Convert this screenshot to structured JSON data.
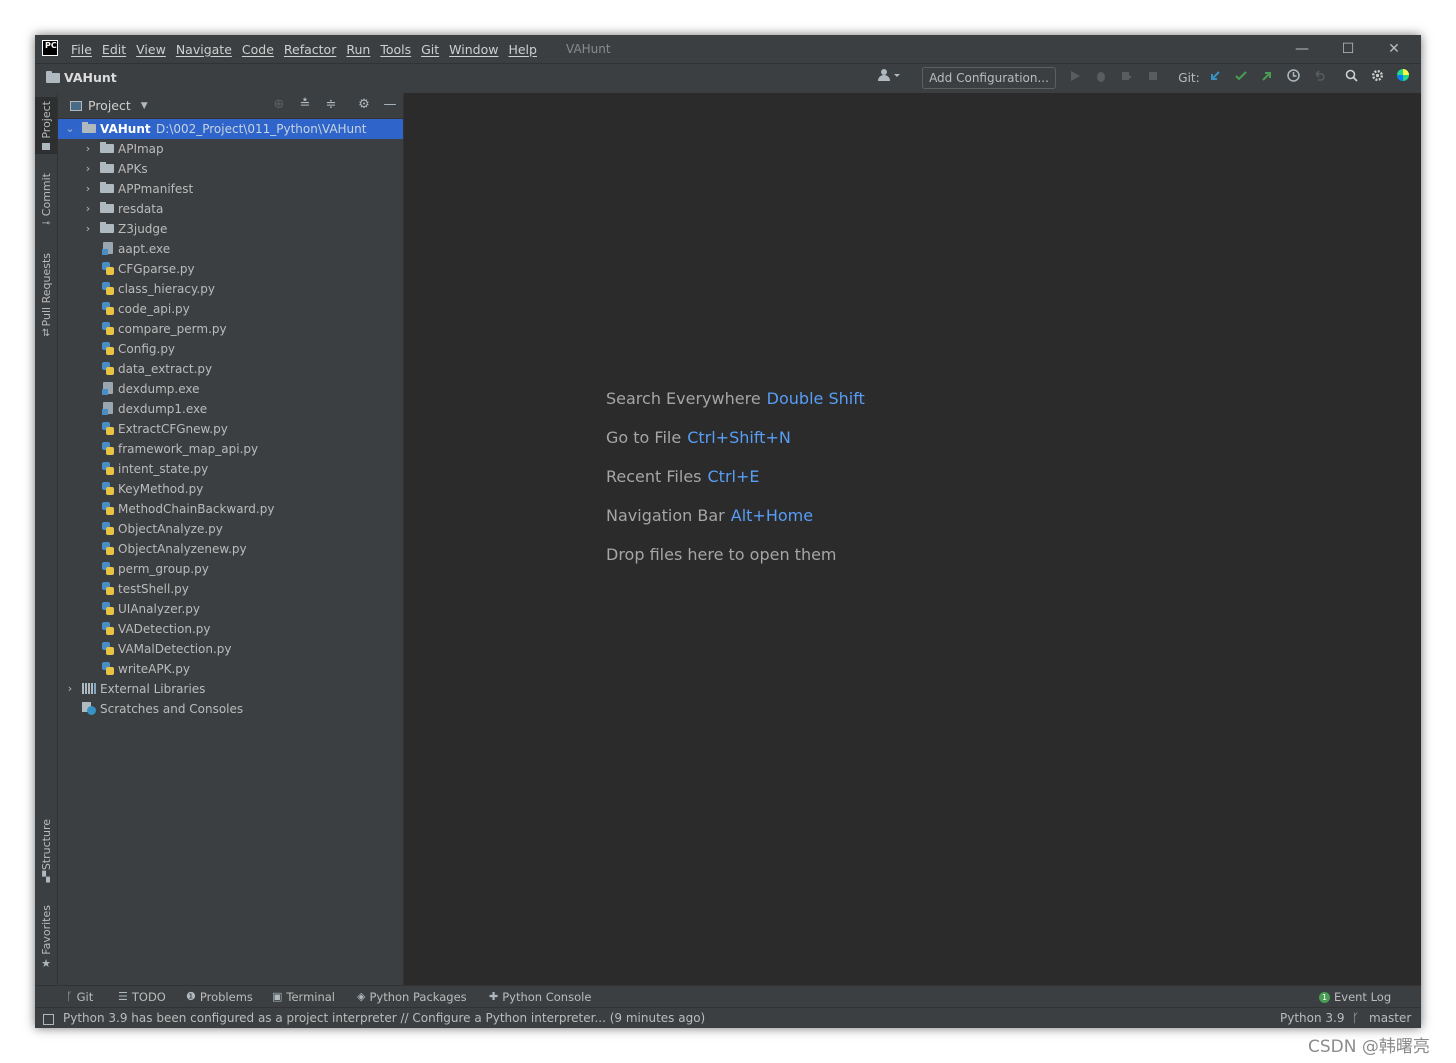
{
  "app": {
    "logo_text": "PC",
    "window_title": "VAHunt",
    "menu": [
      "File",
      "Edit",
      "View",
      "Navigate",
      "Code",
      "Refactor",
      "Run",
      "Tools",
      "Git",
      "Window",
      "Help"
    ]
  },
  "window_controls": {
    "minimize": "—",
    "maximize": "☐",
    "close": "✕"
  },
  "navbar": {
    "breadcrumb": "VAHunt",
    "add_configuration": "Add Configuration...",
    "git_label": "Git:"
  },
  "left_stripe": {
    "project": "Project",
    "commit": "Commit",
    "pull_requests": "Pull Requests",
    "structure": "Structure",
    "favorites": "Favorites"
  },
  "project_panel": {
    "title": "Project",
    "root": {
      "name": "VAHunt",
      "path": "D:\\002_Project\\011_Python\\VAHunt"
    },
    "folders": [
      "APImap",
      "APKs",
      "APPmanifest",
      "resdata",
      "Z3judge"
    ],
    "files": [
      {
        "name": "aapt.exe",
        "type": "exe"
      },
      {
        "name": "CFGparse.py",
        "type": "py"
      },
      {
        "name": "class_hieracy.py",
        "type": "py"
      },
      {
        "name": "code_api.py",
        "type": "py"
      },
      {
        "name": "compare_perm.py",
        "type": "py"
      },
      {
        "name": "Config.py",
        "type": "py"
      },
      {
        "name": "data_extract.py",
        "type": "py"
      },
      {
        "name": "dexdump.exe",
        "type": "exe"
      },
      {
        "name": "dexdump1.exe",
        "type": "exe"
      },
      {
        "name": "ExtractCFGnew.py",
        "type": "py"
      },
      {
        "name": "framework_map_api.py",
        "type": "py"
      },
      {
        "name": "intent_state.py",
        "type": "py"
      },
      {
        "name": "KeyMethod.py",
        "type": "py"
      },
      {
        "name": "MethodChainBackward.py",
        "type": "py"
      },
      {
        "name": "ObjectAnalyze.py",
        "type": "py"
      },
      {
        "name": "ObjectAnalyzenew.py",
        "type": "py"
      },
      {
        "name": "perm_group.py",
        "type": "py"
      },
      {
        "name": "testShell.py",
        "type": "py"
      },
      {
        "name": "UIAnalyzer.py",
        "type": "py"
      },
      {
        "name": "VADetection.py",
        "type": "py"
      },
      {
        "name": "VAMalDetection.py",
        "type": "py"
      },
      {
        "name": "writeAPK.py",
        "type": "py"
      }
    ],
    "external_libraries": "External Libraries",
    "scratches": "Scratches and Consoles"
  },
  "editor_hints": [
    {
      "label": "Search Everywhere",
      "shortcut": "Double Shift"
    },
    {
      "label": "Go to File",
      "shortcut": "Ctrl+Shift+N"
    },
    {
      "label": "Recent Files",
      "shortcut": "Ctrl+E"
    },
    {
      "label": "Navigation Bar",
      "shortcut": "Alt+Home"
    },
    {
      "label": "Drop files here to open them",
      "shortcut": ""
    }
  ],
  "bottom_tabs": {
    "git": "Git",
    "todo": "TODO",
    "problems": "Problems",
    "terminal": "Terminal",
    "python_packages": "Python Packages",
    "python_console": "Python Console",
    "event_log": "Event Log",
    "event_count": "1"
  },
  "status": {
    "message": "Python 3.9 has been configured as a project interpreter // Configure a Python interpreter... (9 minutes ago)",
    "interpreter": "Python 3.9",
    "branch": "master"
  },
  "watermark": "CSDN @韩曙亮",
  "colors": {
    "accent": "#2f65ca",
    "shortcut": "#589df6",
    "panel": "#3c3f41",
    "editor": "#2b2b2b"
  }
}
